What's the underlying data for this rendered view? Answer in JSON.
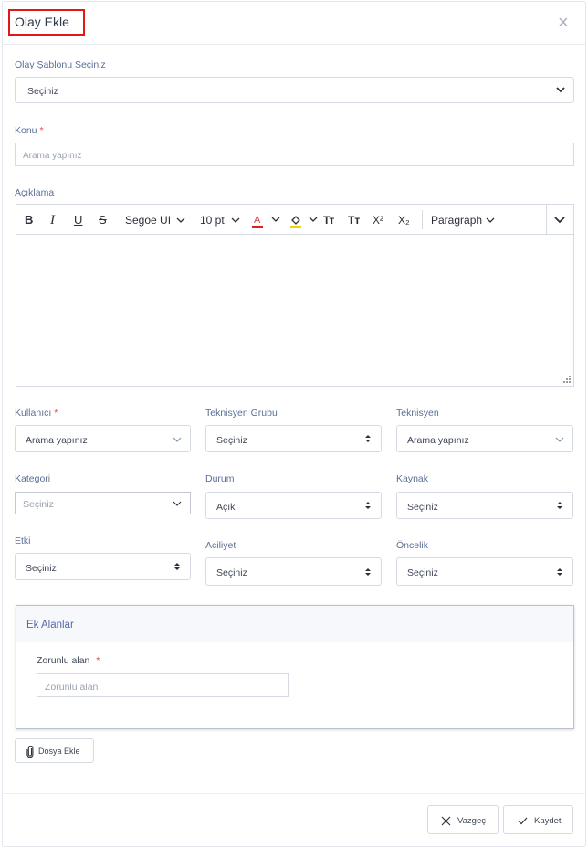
{
  "dialog": {
    "title": "Olay Ekle",
    "close_label": "×"
  },
  "template": {
    "label": "Olay Şablonu Seçiniz",
    "value": "Seçiniz"
  },
  "subject": {
    "label": "Konu",
    "required_mark": "*",
    "placeholder": "Arama yapınız"
  },
  "description": {
    "label": "Açıklama",
    "toolbar": {
      "bold": "B",
      "italic": "I",
      "underline": "U",
      "strikethrough": "S",
      "font_family": "Segoe UI",
      "font_size": "10 pt",
      "font_color": "A",
      "change_case": "Tт",
      "sentence_case": "Tт",
      "superscript": "X²",
      "subscript": "X₂",
      "format": "Paragraph"
    },
    "text": ""
  },
  "user": {
    "label": "Kullanıcı",
    "required_mark": "*",
    "value": "Arama yapınız"
  },
  "tech_group": {
    "label": "Teknisyen Grubu",
    "value": "Seçiniz"
  },
  "technician": {
    "label": "Teknisyen",
    "value": "Arama yapınız"
  },
  "category": {
    "label": "Kategori",
    "placeholder": "Seçiniz"
  },
  "status": {
    "label": "Durum",
    "value": "Açık"
  },
  "source": {
    "label": "Kaynak",
    "value": "Seçiniz"
  },
  "impact": {
    "label": "Etki",
    "value": "Seçiniz"
  },
  "urgency": {
    "label": "Aciliyet",
    "value": "Seçiniz"
  },
  "priority": {
    "label": "Öncelik",
    "value": "Seçiniz"
  },
  "extra_fields": {
    "title": "Ek Alanlar",
    "required_field": {
      "label": "Zorunlu alan",
      "required_mark": "*",
      "placeholder": "Zorunlu alan"
    }
  },
  "attach_button": "Dosya Ekle",
  "footer": {
    "cancel": "Vazgeç",
    "save": "Kaydet"
  },
  "colors": {
    "highlight_box": "#e01818",
    "label": "#5b6f96",
    "font_color_underline": "#e02020",
    "highlight_underline": "#e8d800"
  }
}
